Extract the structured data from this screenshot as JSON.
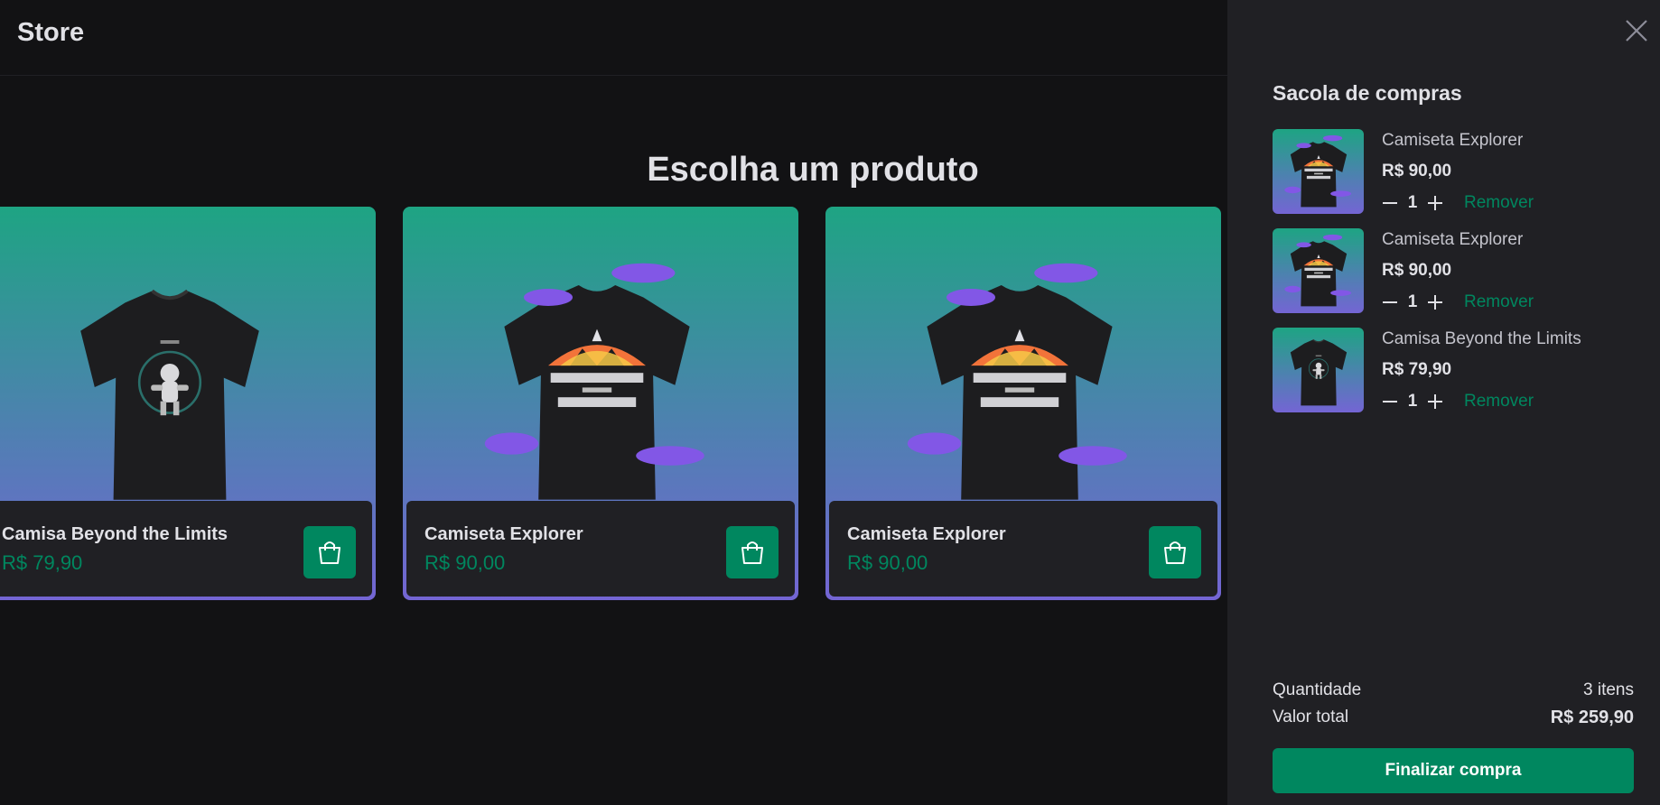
{
  "header": {
    "logo": "Store"
  },
  "main": {
    "title": "Escolha um produto",
    "products": [
      {
        "name": "Camisa Beyond the Limits",
        "price": "R$ 79,90",
        "image": "astronaut-tshirt"
      },
      {
        "name": "Camiseta Explorer",
        "price": "R$ 90,00",
        "image": "beyond-the-limits-tshirt"
      },
      {
        "name": "Camiseta Explorer",
        "price": "R$ 90,00",
        "image": "beyond-the-limits-tshirt"
      }
    ]
  },
  "cart": {
    "title": "Sacola de compras",
    "items": [
      {
        "name": "Camiseta Explorer",
        "price": "R$ 90,00",
        "quantity": "1",
        "remove_label": "Remover"
      },
      {
        "name": "Camiseta Explorer",
        "price": "R$ 90,00",
        "quantity": "1",
        "remove_label": "Remover"
      },
      {
        "name": "Camisa Beyond the Limits",
        "price": "R$ 79,90",
        "quantity": "1",
        "remove_label": "Remover"
      }
    ],
    "quantity_label": "Quantidade",
    "quantity_value": "3 itens",
    "total_label": "Valor total",
    "total_value": "R$ 259,90",
    "checkout_label": "Finalizar compra"
  },
  "colors": {
    "background": "#121214",
    "panel": "#202024",
    "accent": "#00875f",
    "gradient_top": "#1ea483",
    "gradient_bottom": "#7465d4"
  },
  "icons": {
    "bag": "shopping-bag-icon",
    "close": "close-icon",
    "minus": "minus-icon",
    "plus": "plus-icon"
  }
}
